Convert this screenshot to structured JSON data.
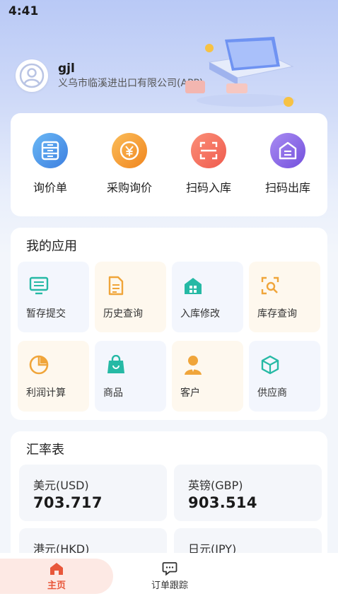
{
  "status_bar": {
    "time": "4:41"
  },
  "profile": {
    "username": "gjl",
    "company": "义乌市临溪进出口有限公司(APP)"
  },
  "quick_actions": [
    {
      "label": "询价单",
      "icon": "inquiry-icon",
      "color": "#4a93e6"
    },
    {
      "label": "采购询价",
      "icon": "yen-icon",
      "color": "#f39a2c"
    },
    {
      "label": "扫码入库",
      "icon": "scan-icon",
      "color": "#f16b5a"
    },
    {
      "label": "扫码出库",
      "icon": "warehouse-icon",
      "color": "#8a68e6"
    }
  ],
  "my_apps": {
    "title": "我的应用",
    "items": [
      {
        "label": "暂存提交",
        "icon": "monitor-icon",
        "tone": "blue"
      },
      {
        "label": "历史查询",
        "icon": "document-icon",
        "tone": "orange"
      },
      {
        "label": "入库修改",
        "icon": "house-icon",
        "tone": "blue"
      },
      {
        "label": "库存查询",
        "icon": "scan-search-icon",
        "tone": "orange"
      },
      {
        "label": "利润计算",
        "icon": "pie-chart-icon",
        "tone": "orange"
      },
      {
        "label": "商品",
        "icon": "shopping-bag-icon",
        "tone": "blue"
      },
      {
        "label": "客户",
        "icon": "person-icon",
        "tone": "orange"
      },
      {
        "label": "供应商",
        "icon": "cube-icon",
        "tone": "blue"
      }
    ]
  },
  "exchange_rates": {
    "title": "汇率表",
    "items": [
      {
        "currency": "美元(USD)",
        "value": "703.717"
      },
      {
        "currency": "英镑(GBP)",
        "value": "903.514"
      },
      {
        "currency": "港元(HKD)",
        "value": ""
      },
      {
        "currency": "日元(JPY)",
        "value": ""
      }
    ]
  },
  "tabbar": {
    "home_label": "主页",
    "orders_label": "订单跟踪"
  },
  "colors": {
    "accent": "#e8573a",
    "teal": "#26b9a5",
    "orange": "#f0a53a"
  }
}
